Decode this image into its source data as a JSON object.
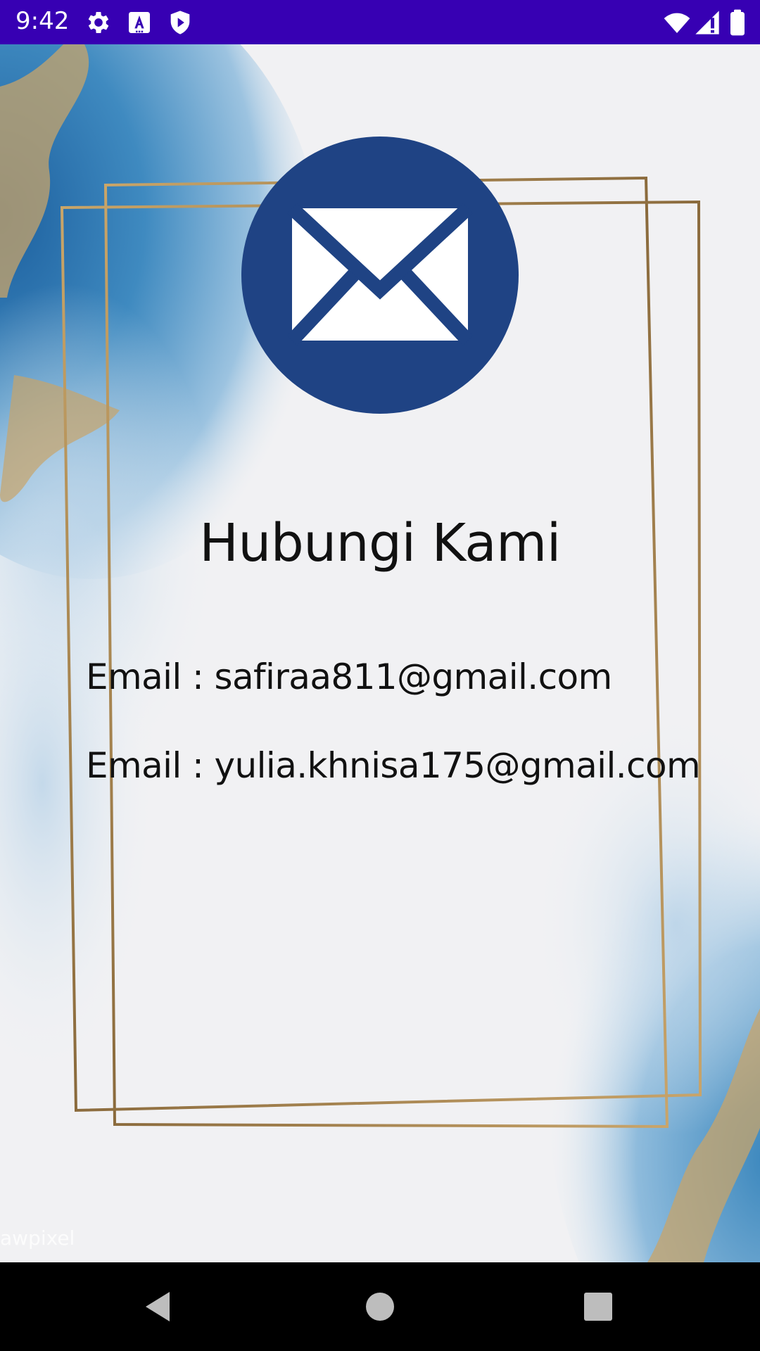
{
  "status_bar": {
    "time": "9:42",
    "icons": [
      "settings-icon",
      "text-a-icon",
      "shield-play-icon",
      "wifi-icon",
      "signal-icon",
      "battery-icon"
    ],
    "background": "#3700B3"
  },
  "page": {
    "title": "Hubungi Kami",
    "emails": [
      "Email : safiraa811@gmail.com",
      "Email : yulia.khnisa175@gmail.com"
    ],
    "watermark": "awpixel",
    "accent_color": "#1F4384",
    "frame_color": "#A8885A"
  },
  "nav_bar": {
    "buttons": [
      "back-icon",
      "home-icon",
      "recents-icon"
    ]
  }
}
